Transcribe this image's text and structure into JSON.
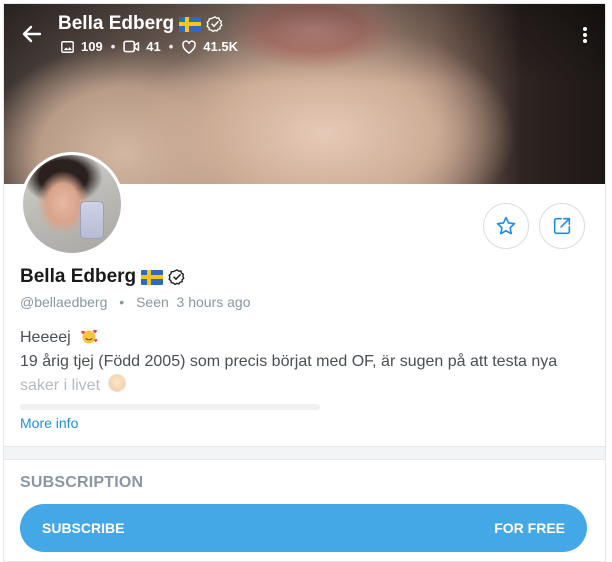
{
  "header": {
    "name": "Bella Edberg",
    "stats": {
      "photos": "109",
      "videos": "41",
      "likes": "41.5K"
    },
    "icons": [
      "back-arrow-icon",
      "flag-sweden-icon",
      "verified-icon",
      "image-icon",
      "video-icon",
      "heart-icon",
      "more-vertical-icon"
    ]
  },
  "profile": {
    "name": "Bella Edberg",
    "handle": "@bellaedberg",
    "separator": "•",
    "seen": "Seen  3 hours ago",
    "bio": {
      "line1": "Heeeej",
      "line2": "19 årig tjej (Född 2005) som precis börjat med OF, är sugen på att testa nya",
      "line3": "saker i livet"
    },
    "more_info": "More info"
  },
  "subscription": {
    "title": "SUBSCRIPTION",
    "subscribe_label": "SUBSCRIBE",
    "price_label": "FOR FREE"
  },
  "colors": {
    "accent": "#45a8e6",
    "link": "#1d8fe1",
    "muted": "#8a96a3"
  }
}
